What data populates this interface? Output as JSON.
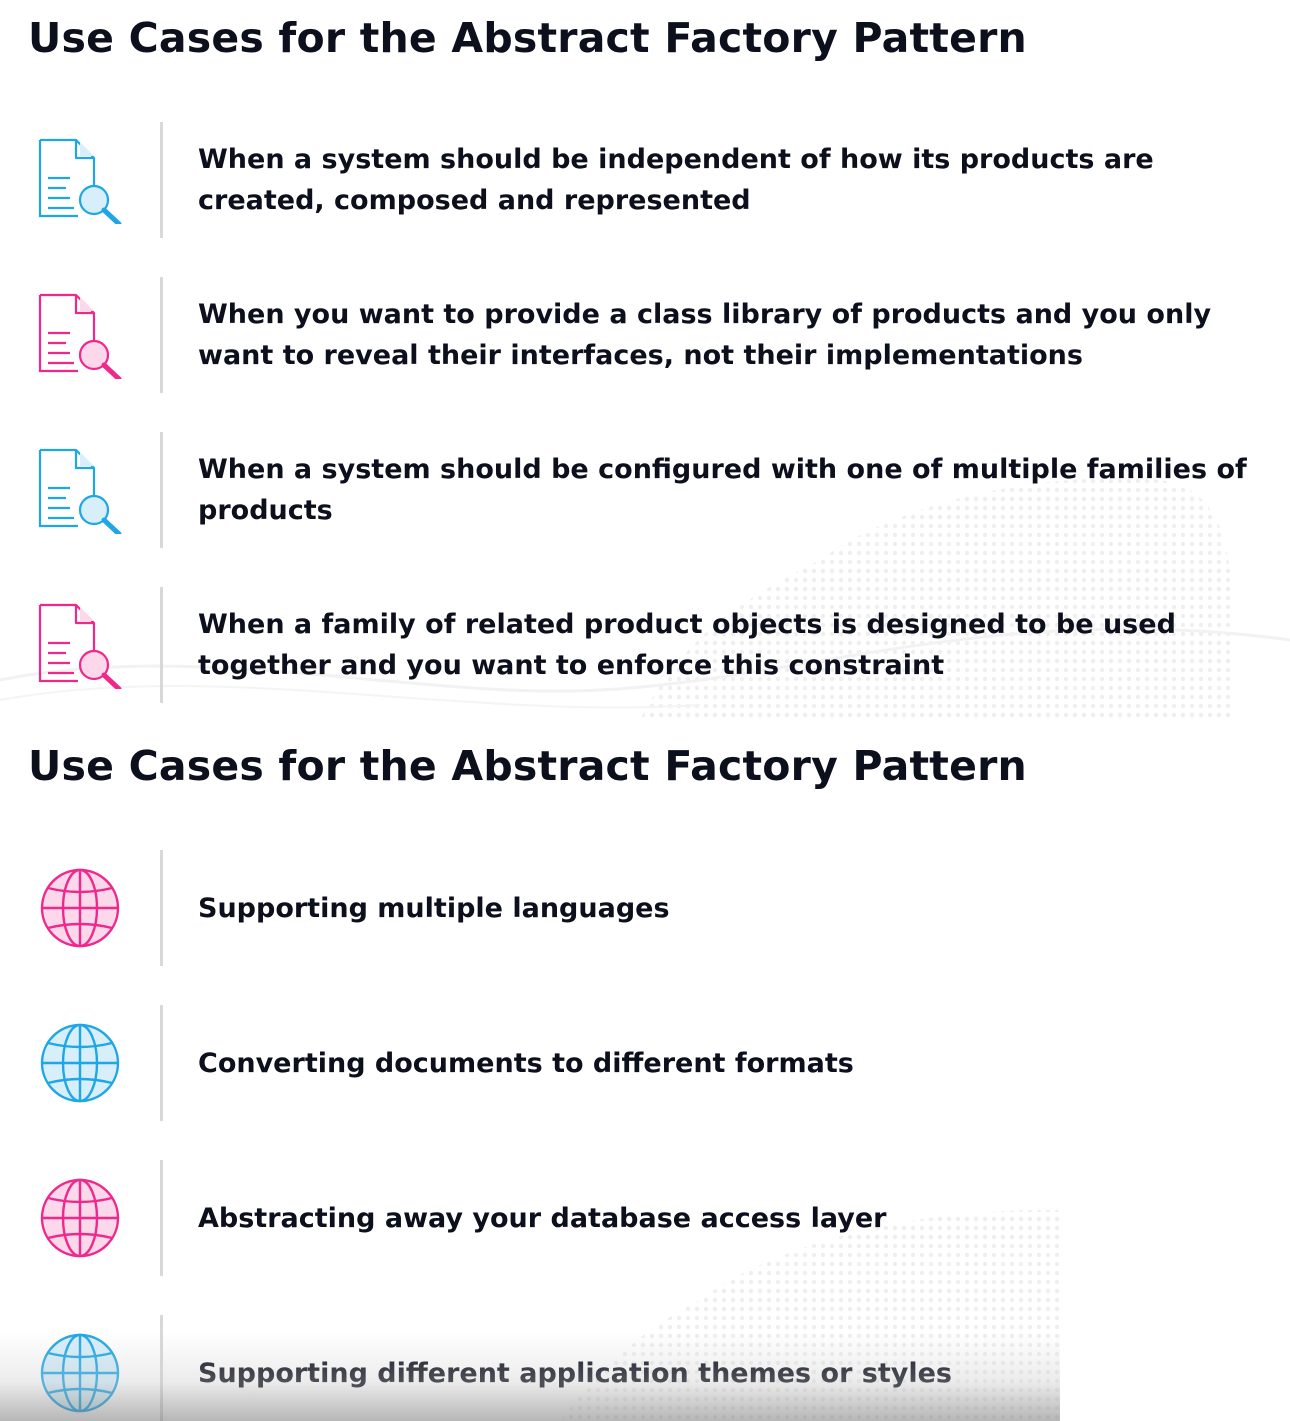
{
  "colors": {
    "blue": "#1fa6e6",
    "pink": "#f0288c",
    "blue_fill": "#d6effb",
    "pink_fill": "#fcd8ea",
    "text": "#0c0f1c",
    "divider": "#d8d8d8"
  },
  "slides": [
    {
      "title": "Use Cases for the Abstract Factory Pattern",
      "items": [
        {
          "icon": "document-search-icon",
          "color": "blue",
          "text": "When a system should be independent of how its products are created, composed and represented"
        },
        {
          "icon": "document-search-icon",
          "color": "pink",
          "text": "When you want to provide a class library of products and you only want to reveal their interfaces, not their implementations"
        },
        {
          "icon": "document-search-icon",
          "color": "blue",
          "text": "When a system should be configured with one of multiple families of products"
        },
        {
          "icon": "document-search-icon",
          "color": "pink",
          "text": "When a family of related product objects is designed to be used together and you want to enforce this constraint"
        }
      ]
    },
    {
      "title": "Use Cases for the Abstract Factory Pattern",
      "items": [
        {
          "icon": "globe-icon",
          "color": "pink",
          "text": "Supporting multiple languages"
        },
        {
          "icon": "globe-icon",
          "color": "blue",
          "text": "Converting documents to different formats"
        },
        {
          "icon": "globe-icon",
          "color": "pink",
          "text": "Abstracting away your database access layer"
        },
        {
          "icon": "globe-icon",
          "color": "blue",
          "text": "Supporting different application themes or styles"
        }
      ]
    }
  ]
}
